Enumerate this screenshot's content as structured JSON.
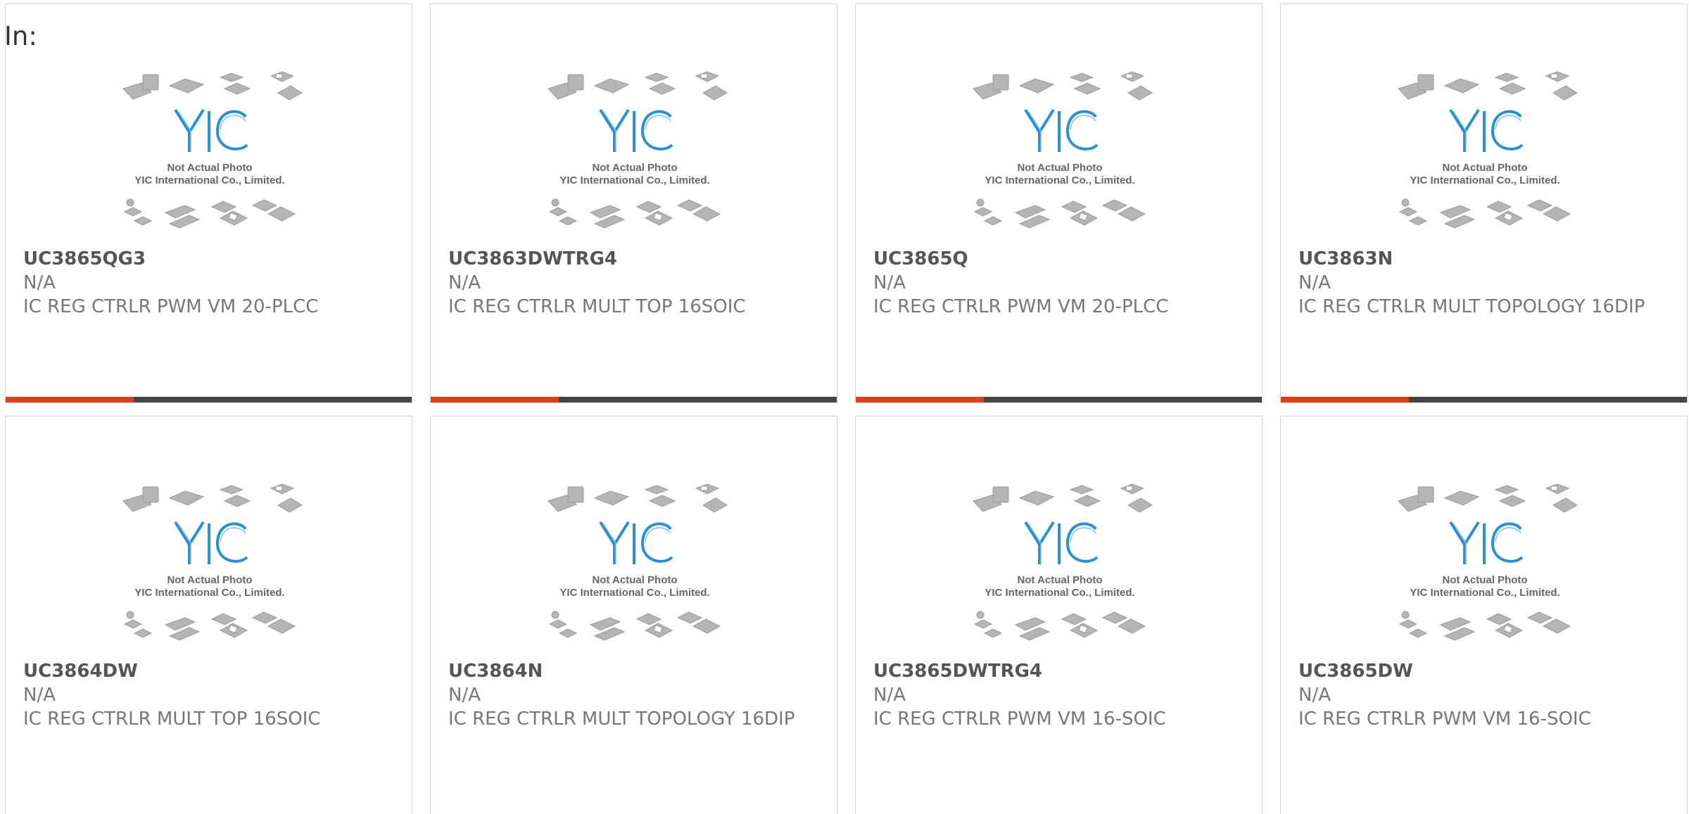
{
  "header": {
    "filter_label": "In:"
  },
  "photo": {
    "brand": "YIC",
    "caption_line1": "Not Actual Photo",
    "caption_line2": "YIC International Co., Limited."
  },
  "colors": {
    "accent_bar": "#e03c16",
    "dark_bar": "#444444",
    "logo_blue": "#2b8fd3"
  },
  "products": [
    {
      "part": "UC3865QG3",
      "manufacturer": "N/A",
      "description": "IC REG CTRLR PWM VM 20-PLCC"
    },
    {
      "part": "UC3863DWTRG4",
      "manufacturer": "N/A",
      "description": "IC REG CTRLR MULT TOP 16SOIC"
    },
    {
      "part": "UC3865Q",
      "manufacturer": "N/A",
      "description": "IC REG CTRLR PWM VM 20-PLCC"
    },
    {
      "part": "UC3863N",
      "manufacturer": "N/A",
      "description": "IC REG CTRLR MULT TOPOLOGY 16DIP"
    },
    {
      "part": "UC3864DW",
      "manufacturer": "N/A",
      "description": "IC REG CTRLR MULT TOP 16SOIC"
    },
    {
      "part": "UC3864N",
      "manufacturer": "N/A",
      "description": "IC REG CTRLR MULT TOPOLOGY 16DIP"
    },
    {
      "part": "UC3865DWTRG4",
      "manufacturer": "N/A",
      "description": "IC REG CTRLR PWM VM 16-SOIC"
    },
    {
      "part": "UC3865DW",
      "manufacturer": "N/A",
      "description": "IC REG CTRLR PWM VM 16-SOIC"
    }
  ]
}
